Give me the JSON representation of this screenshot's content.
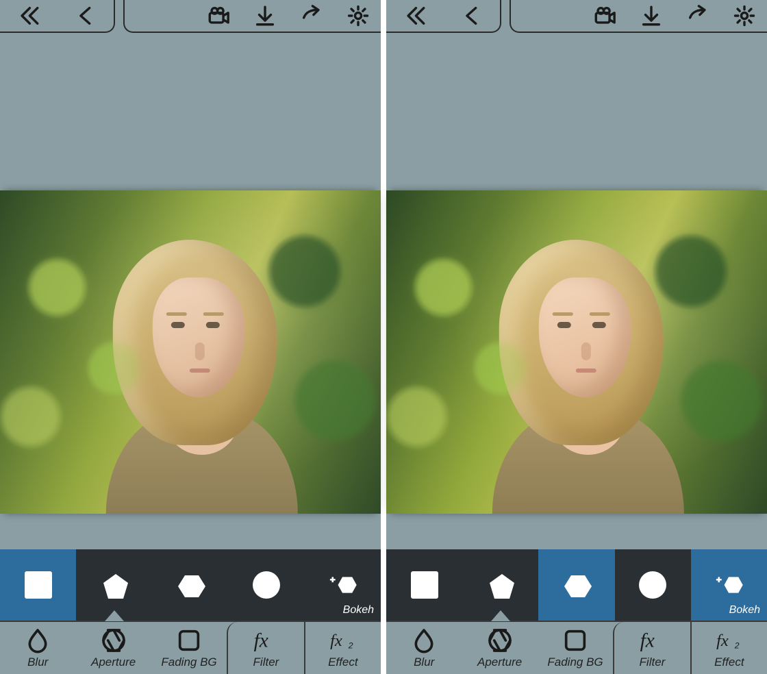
{
  "shapes_label_bokeh": "Bokeh",
  "tabs": {
    "blur": "Blur",
    "aperture": "Aperture",
    "fading": "Fading BG",
    "filter": "Filter",
    "effect": "Effect"
  },
  "panes": [
    {
      "shape_selection": [
        true,
        false,
        false,
        false,
        false
      ],
      "active_tab": "aperture"
    },
    {
      "shape_selection": [
        false,
        false,
        true,
        false,
        true
      ],
      "active_tab": "aperture"
    }
  ]
}
